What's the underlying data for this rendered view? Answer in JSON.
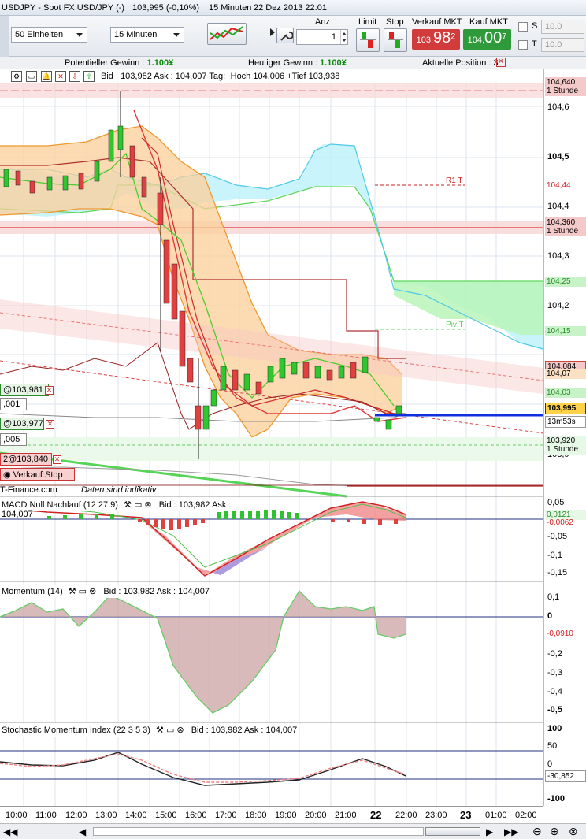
{
  "window": {
    "instrument": "USDJPY - Spot FX USD/JPY (-)",
    "price": "103,995 (-0,10%)",
    "interval": "15 Minuten",
    "datetime": "22 Dez 2013 22:01"
  },
  "toolbar": {
    "units_select": "50 Einheiten",
    "interval_select": "15 Minuten",
    "anz_label": "Anz",
    "anz_value": "1",
    "limit_label": "Limit",
    "stop_label": "Stop",
    "sell_label": "Verkauf MKT",
    "sell_price_main": "103,",
    "sell_price_big": "98",
    "sell_price_sup": "2",
    "buy_label": "Kauf MKT",
    "buy_price_main": "104,",
    "buy_price_big": "00",
    "buy_price_sup": "7",
    "s_label": "S",
    "t_label": "T",
    "s_value": "10.0",
    "t_value": "10.0",
    "sell_color": "#d23b3b",
    "buy_color": "#2f9a3a"
  },
  "infobar": {
    "pot_label": "Potentieller Gewinn : ",
    "pot_value": "1.100¥",
    "today_label": "Heutiger Gewinn : ",
    "today_value": "1.100¥",
    "position_label": "Aktuelle Position : 3"
  },
  "main_chart": {
    "header": "Bid : 103,982 Ask : 104,007 Tag:+Hoch 104,006 +Tief 103,938",
    "r1_label": "R1 T",
    "piv_label": "Piv T",
    "source": "T-Finance.com",
    "indicative": "Daten sind indikativ",
    "orders": [
      {
        "text": "@103,981",
        "sub": ",001"
      },
      {
        "text": "@103,977",
        "sub": ",005"
      },
      {
        "text": "2@103,840",
        "sub": "Verkauf:Stop"
      }
    ],
    "y_ticks": [
      "104,6",
      "104,5",
      "104,4",
      "104,3",
      "104,2"
    ],
    "y_tick_lower": "103,9"
  },
  "price_tags": [
    {
      "text": "104,640",
      "sub": "1 Stunde",
      "color": "#f4c9c9"
    },
    {
      "text": "104,44",
      "sub": "",
      "color": "#ffffff"
    },
    {
      "text": "104,360",
      "sub": "1 Stunde",
      "color": "#f4c9c9"
    },
    {
      "text": "104,25",
      "sub": "",
      "color": "#c8f2c8"
    },
    {
      "text": "104,15",
      "sub": "",
      "color": "#c8f2c8"
    },
    {
      "text": "104,084",
      "sub": "",
      "color": "#f4c9c9"
    },
    {
      "text": "104,07",
      "sub": "",
      "color": "#fbe1c4"
    },
    {
      "text": "104,03",
      "sub": "",
      "color": "#c8f2c8"
    },
    {
      "text": "103,995",
      "sub": "",
      "color": "#ffd24a"
    },
    {
      "text": "13m53s",
      "sub": "",
      "color": "#ffffff"
    },
    {
      "text": "103,920",
      "sub": "1 Stunde",
      "color": "#e6f8e6"
    }
  ],
  "macd": {
    "header_name": "MACD Null Nachlauf (12 27 9)",
    "header_quote": "Bid : 103,982 Ask : 104,007",
    "ticks": [
      "0,05",
      "-0,05",
      "-0,1",
      "-0,15"
    ],
    "tag_a": "0,0121",
    "tag_b": "-0,0062"
  },
  "momentum": {
    "header_name": "Momentum (14)",
    "header_quote": "Bid : 103,982 Ask : 104,007",
    "ticks": [
      "0,1",
      "0",
      "-0,2",
      "-0,3",
      "-0,4",
      "-0,5"
    ],
    "tag": "-0,0910"
  },
  "smi": {
    "header_name": "Stochastic Momentum Index (22 3 5 3)",
    "header_quote": "Bid : 103,982 Ask : 104,007",
    "ticks": [
      "100",
      "50",
      "0",
      "-100"
    ],
    "tag": "-30,852"
  },
  "time_axis": [
    "10:00",
    "11:00",
    "12:00",
    "13:00",
    "14:00",
    "15:00",
    "16:00",
    "17:00",
    "18:00",
    "19:00",
    "20:00",
    "21:00",
    "22",
    "22:00",
    "23:00",
    "23",
    "01:00",
    "02:00"
  ]
}
